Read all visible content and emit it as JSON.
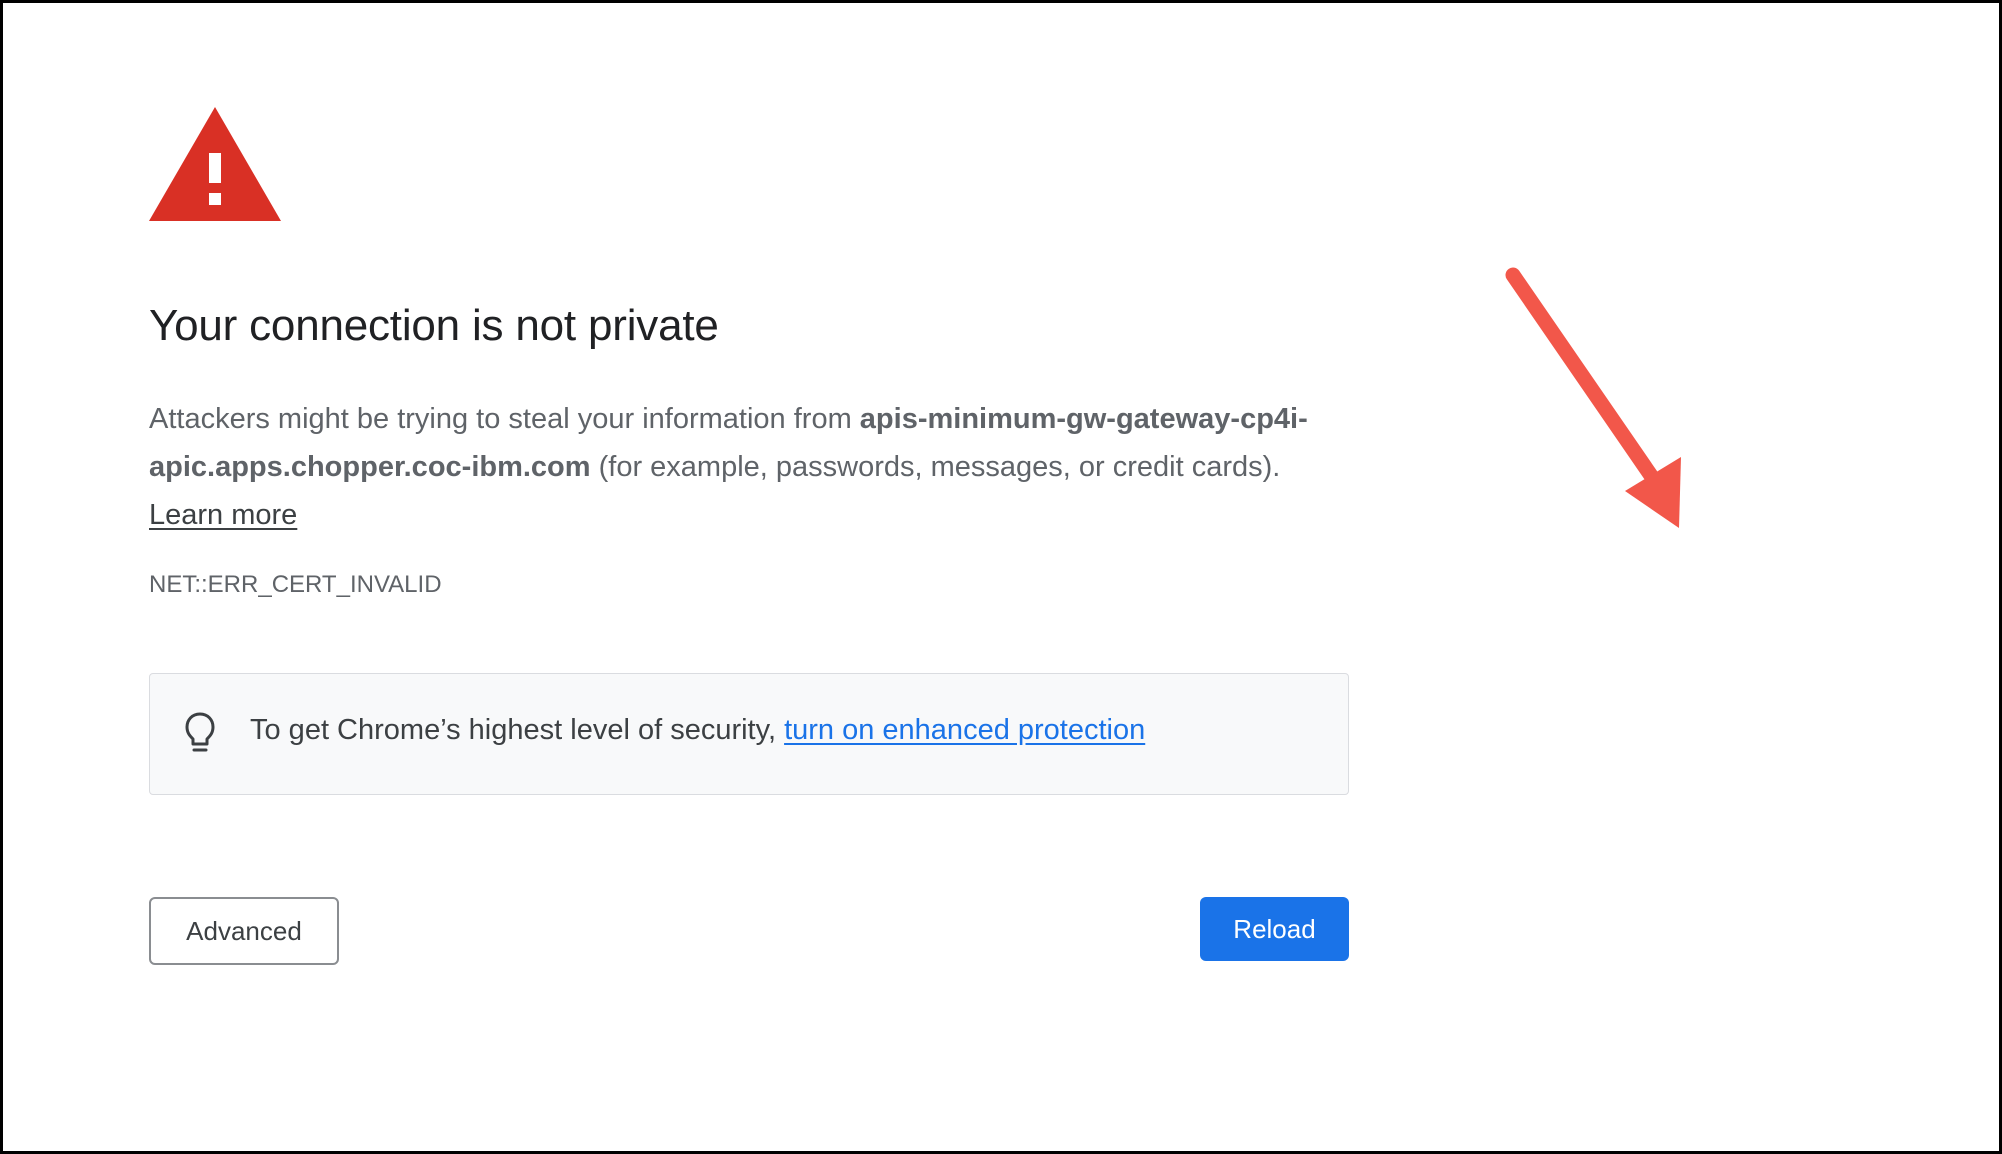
{
  "page": {
    "title": "Your connection is not private",
    "description": {
      "prefix": "Attackers might be trying to steal your information from ",
      "domain": "apis-minimum-gw-gateway-cp4i-apic.apps.chopper.coc-ibm.com",
      "suffix": " (for example, passwords, messages, or credit cards). ",
      "learn_more_label": "Learn more"
    },
    "error_code": "NET::ERR_CERT_INVALID",
    "tip": {
      "text": "To get Chrome’s highest level of security, ",
      "link_label": "turn on enhanced protection"
    },
    "buttons": {
      "advanced_label": "Advanced",
      "reload_label": "Reload"
    }
  },
  "icons": {
    "warning": "warning-triangle-icon",
    "tip": "lightbulb-icon",
    "annotation": "red-arrow-icon"
  },
  "colors": {
    "warning_red": "#d93025",
    "link_blue": "#1a73e8",
    "reload_button_bg": "#1a73e8",
    "annotation_arrow": "#f2574a",
    "tip_box_bg": "#f8f9fa"
  }
}
